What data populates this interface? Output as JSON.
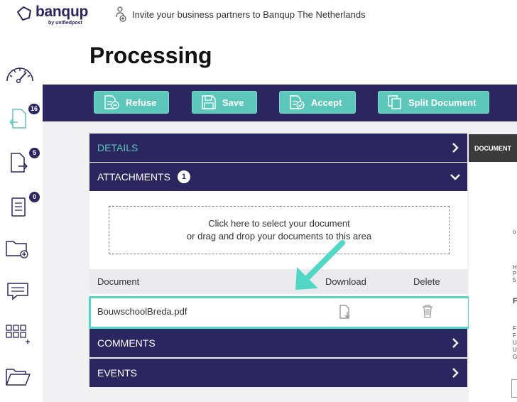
{
  "brand": {
    "name": "banqup",
    "sub": "by unifiedpost"
  },
  "invite": {
    "text": "Invite your business partners to Banqup The Netherlands"
  },
  "sidebar": {
    "items": [
      {
        "icon": "dashboard-gauge-icon",
        "badge": ""
      },
      {
        "icon": "incoming-documents-icon",
        "badge": "16"
      },
      {
        "icon": "outgoing-documents-icon",
        "badge": "5"
      },
      {
        "icon": "checklist-documents-icon",
        "badge": "0"
      },
      {
        "icon": "add-folder-icon",
        "badge": ""
      },
      {
        "icon": "messages-icon",
        "badge": ""
      },
      {
        "icon": "apps-grid-add-icon",
        "badge": ""
      },
      {
        "icon": "open-folder-icon",
        "badge": ""
      }
    ]
  },
  "page": {
    "title": "Processing"
  },
  "toolbar": {
    "refuse_label": "Refuse",
    "save_label": "Save",
    "accept_label": "Accept",
    "split_label": "Split Document"
  },
  "details": {
    "label": "DETAILS"
  },
  "attachments": {
    "label": "ATTACHMENTS",
    "count": "1",
    "dropzone_line1": "Click here to select your document",
    "dropzone_line2": "or drag and drop your documents to this area",
    "columns": {
      "document": "Document",
      "download": "Download",
      "delete": "Delete"
    },
    "rows": [
      {
        "name": "BouwschoolBreda.pdf"
      }
    ]
  },
  "comments": {
    "label": "COMMENTS"
  },
  "events": {
    "label": "EVENTS"
  },
  "document_tab": {
    "label": "DOCUMENT"
  },
  "preview_text": [
    "o",
    "H",
    "P",
    "5",
    "F",
    "F",
    "F",
    "U",
    "U",
    "G"
  ],
  "colors": {
    "brand": "#2b2560",
    "accent": "#5ec7bc",
    "highlight": "#52d6c6"
  }
}
